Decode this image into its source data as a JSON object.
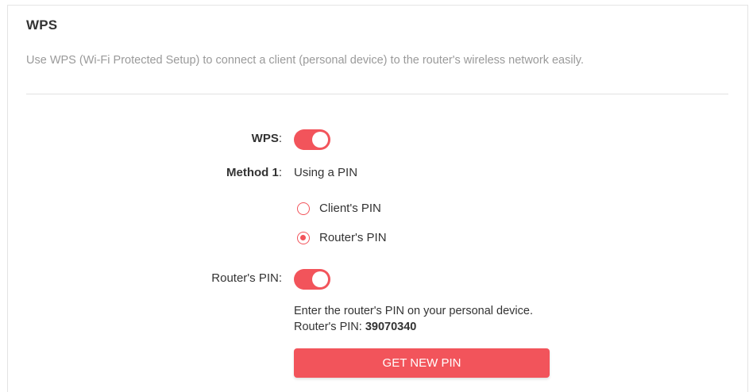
{
  "section": {
    "title": "WPS",
    "description": "Use WPS (Wi-Fi Protected Setup) to connect a client (personal device) to the router's wireless network easily."
  },
  "wps": {
    "label": "WPS",
    "enabled": true
  },
  "method1": {
    "label": "Method 1",
    "value": "Using a PIN",
    "options": [
      {
        "label": "Client's PIN",
        "selected": false
      },
      {
        "label": "Router's PIN",
        "selected": true
      }
    ]
  },
  "router_pin": {
    "label": "Router's PIN",
    "enabled": true,
    "instruction": "Enter the router's PIN on your personal device.",
    "pin_prefix": "Router's PIN:",
    "pin_value": "39070340",
    "button_label": "GET NEW PIN"
  },
  "colors": {
    "accent": "#f2545b",
    "text": "#333333",
    "muted": "#9a9a9a"
  }
}
